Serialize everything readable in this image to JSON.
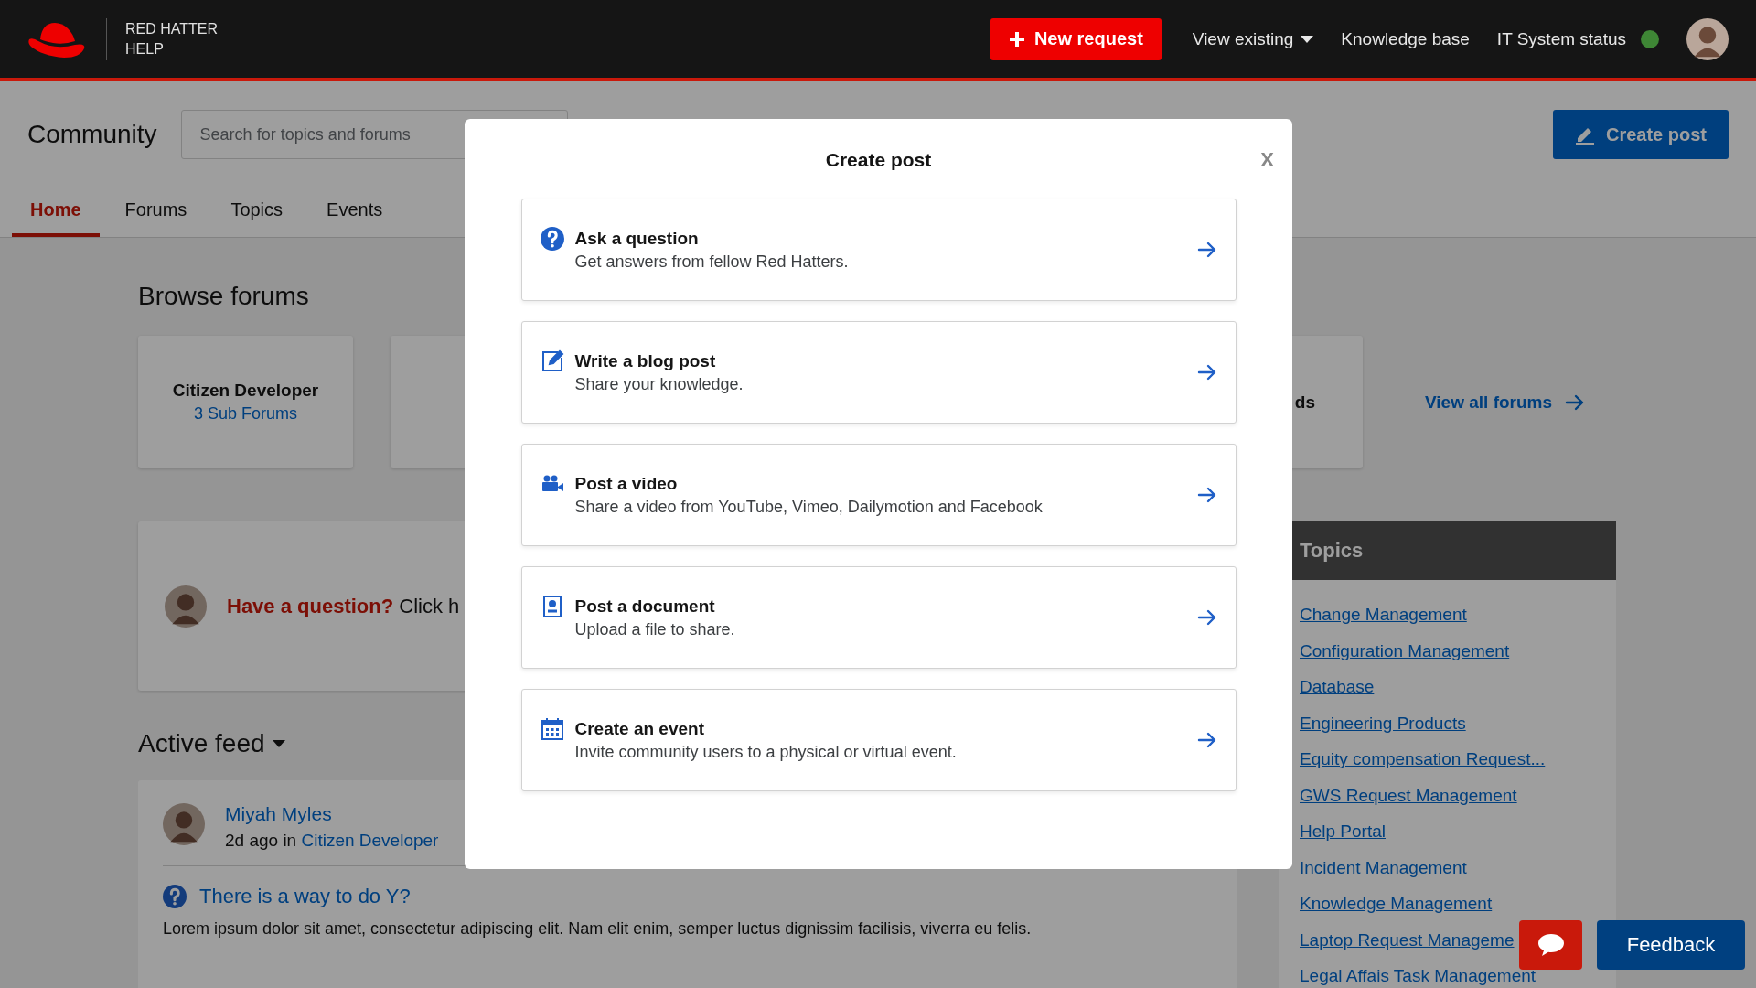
{
  "header": {
    "brand_line_1": "RED HATTER",
    "brand_line_2": "HELP",
    "new_request": "New request",
    "nav": [
      {
        "label": "View existing",
        "kind": "dropdown"
      },
      {
        "label": "Knowledge base",
        "kind": "link"
      },
      {
        "label": "IT System status",
        "kind": "status"
      }
    ]
  },
  "community": {
    "title": "Community",
    "search": {
      "placeholder": "Search for topics and forums"
    },
    "create_post": "Create post",
    "tabs": [
      {
        "label": "Home",
        "selected": true
      },
      {
        "label": "Forums",
        "selected": false
      },
      {
        "label": "Topics",
        "selected": false
      },
      {
        "label": "Events",
        "selected": false
      }
    ]
  },
  "browse_forums": {
    "heading": "Browse forums",
    "cards": [
      {
        "title": "Citizen Developer",
        "subtitle": "3 Sub Forums",
        "kind": "full"
      },
      {
        "kind": "covered"
      },
      {
        "title": "ds",
        "kind": "partial"
      }
    ],
    "view_all": "View all forums"
  },
  "question_prompt": {
    "highlight": "Have a question?",
    "text": "Click h"
  },
  "active_feed": {
    "heading": "Active feed",
    "post": {
      "author": "Miyah Myles",
      "meta_prefix": "2d ago in",
      "forum": "Citizen Developer",
      "title": "There is a way to do Y?",
      "body": "Lorem ipsum dolor sit amet, consectetur adipiscing elit. Nam elit enim, semper luctus dignissim facilisis, viverra eu felis."
    }
  },
  "topics": {
    "heading": "Topics",
    "items": [
      "Change Management",
      "Configuration Management",
      "Database",
      "Engineering Products",
      "Equity compensation Request...",
      "GWS Request Management",
      "Help Portal",
      "Incident Management",
      "Knowledge Management",
      "Laptop Request Manageme",
      "Legal Affais Task Management"
    ]
  },
  "modal": {
    "title": "Create post",
    "close": "X",
    "options": [
      {
        "kind": "question",
        "title": "Ask a question",
        "description": "Get answers from fellow Red Hatters."
      },
      {
        "kind": "blog",
        "title": "Write a blog post",
        "description": "Share your knowledge."
      },
      {
        "kind": "video",
        "title": "Post a video",
        "description": "Share a video from YouTube, Vimeo, Dailymotion and Facebook"
      },
      {
        "kind": "document",
        "title": "Post a document",
        "description": "Upload a file to share."
      },
      {
        "kind": "event",
        "title": "Create an event",
        "description": "Invite community users to a physical or virtual event."
      }
    ]
  },
  "feedback": "Feedback"
}
